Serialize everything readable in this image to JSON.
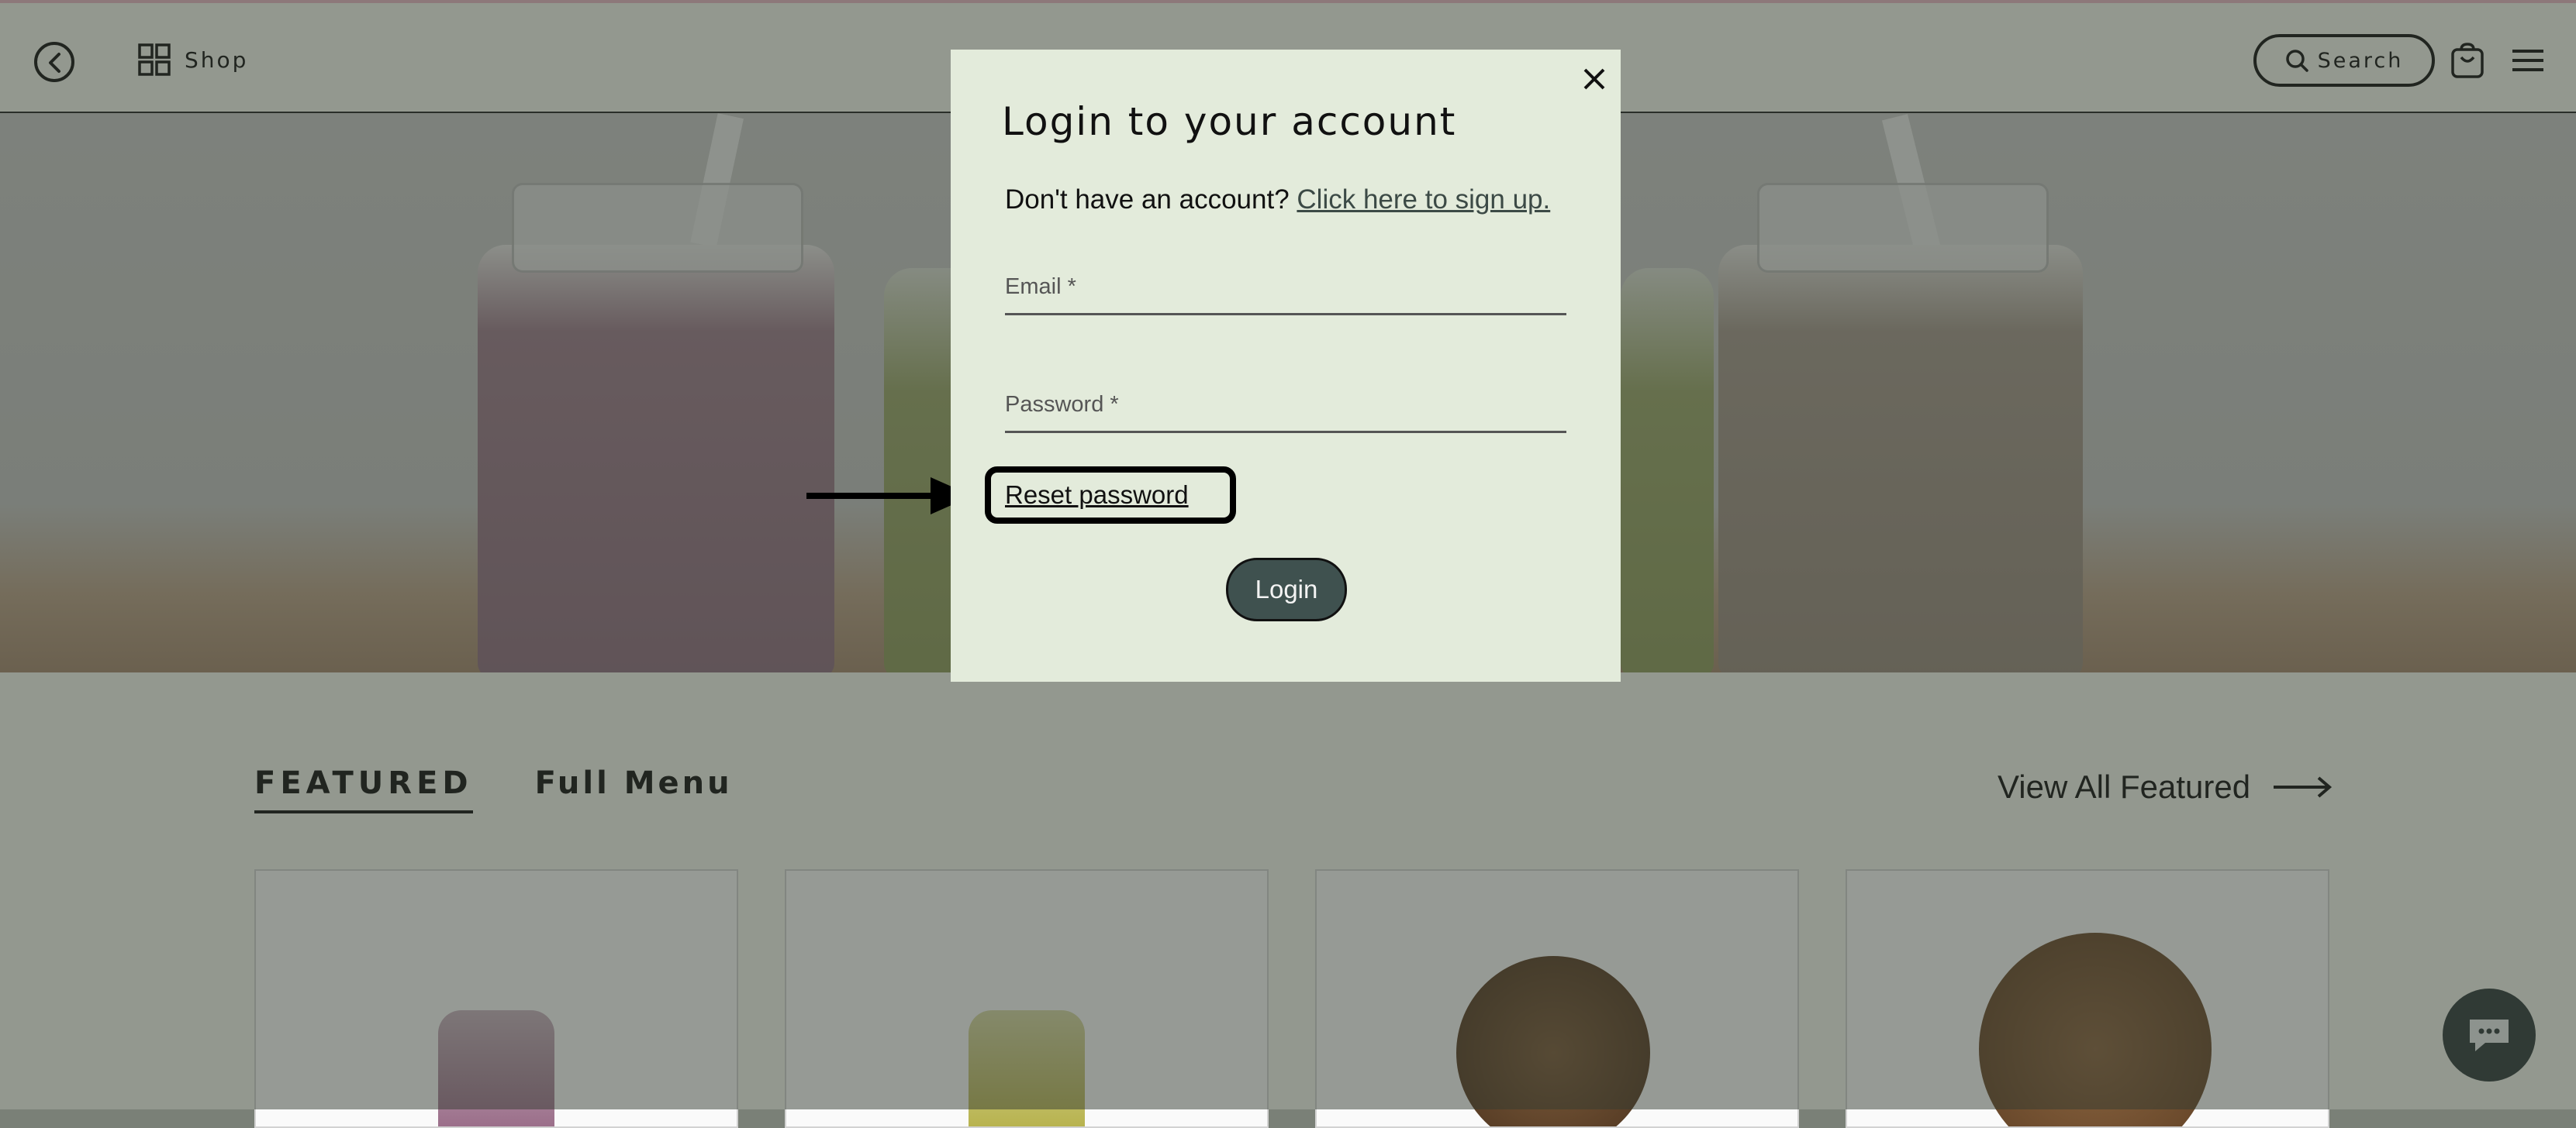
{
  "header": {
    "shop_label": "Shop",
    "search_label": "Search"
  },
  "featured": {
    "tab_featured": "FEATURED",
    "tab_full_menu": "Full Menu",
    "view_all_label": "View All Featured"
  },
  "modal": {
    "title": "Login to your account",
    "signup_prompt": "Don't have an account?",
    "signup_link": "Click here to sign up.",
    "email_label": "Email *",
    "email_value": "",
    "password_label": "Password *",
    "password_value": "",
    "reset_link": "Reset password",
    "login_button": "Login"
  },
  "colors": {
    "modal_bg": "#e3ebdb",
    "login_button_bg": "#3f514f",
    "overlay": "rgba(50,58,48,0.50)",
    "chat_button_bg": "#2f3a3a"
  },
  "icons": {
    "back": "back-arrow-circle-icon",
    "shop": "grid-icon",
    "search": "search-icon",
    "cart": "shopping-bag-icon",
    "menu": "hamburger-menu-icon",
    "close": "close-icon",
    "view_all": "long-arrow-right-icon",
    "chat": "chat-bubble-icon"
  }
}
